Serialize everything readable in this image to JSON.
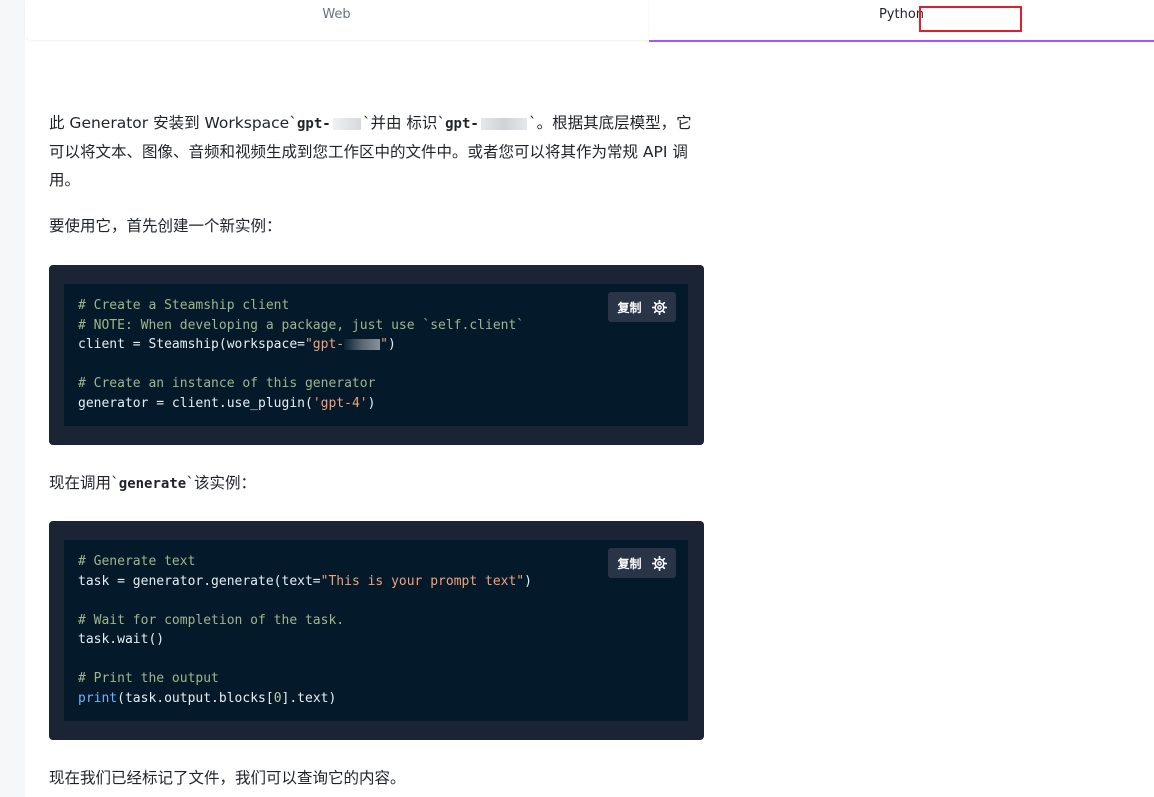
{
  "tabs": [
    {
      "label": "Web",
      "active": false
    },
    {
      "label": "Python",
      "active": true
    }
  ],
  "intro": {
    "part1": "此 Generator 安装到 Workspace`",
    "code1": "gpt-",
    "part2": "`并由 标识`",
    "code2": "gpt-",
    "part3": "`。根据其底层模型，它可以将文本、图像、音频和视频生成到您工作区中的文件中。或者您可以将其作为常规 API 调用。"
  },
  "instruction_create": "要使用它，首先创建一个新实例：",
  "code_block_1": {
    "copy_label": "复制",
    "line1": "# Create a Steamship client",
    "line2": "# NOTE: When developing a package, just use `self.client`",
    "line3_a": "client = Steamship(workspace=",
    "line3_str": "\"gpt-",
    "line3_str_end": "\"",
    "line3_b": ")",
    "line5": "# Create an instance of this generator",
    "line6_a": "generator = client.use_plugin(",
    "line6_str": "'gpt-4'",
    "line6_b": ")"
  },
  "instruction_generate": {
    "part1": "现在调用`",
    "code": "generate",
    "part2": "`该实例："
  },
  "code_block_2": {
    "copy_label": "复制",
    "line1": "# Generate text",
    "line2_a": "task = generator.generate(text=",
    "line2_str": "\"This is your prompt text\"",
    "line2_b": ")",
    "line4": "# Wait for completion of the task.",
    "line5": "task.wait()",
    "line7": "# Print the output",
    "line8_func": "print",
    "line8_a": "(task.output.blocks[",
    "line8_num": "0",
    "line8_b": "].text)"
  },
  "outro": "现在我们已经标记了文件，我们可以查询它的内容。",
  "colors": {
    "accent": "#a855f7",
    "highlight": "#e11d2e",
    "code_bg": "#04192a",
    "code_frame": "#1b2434"
  }
}
